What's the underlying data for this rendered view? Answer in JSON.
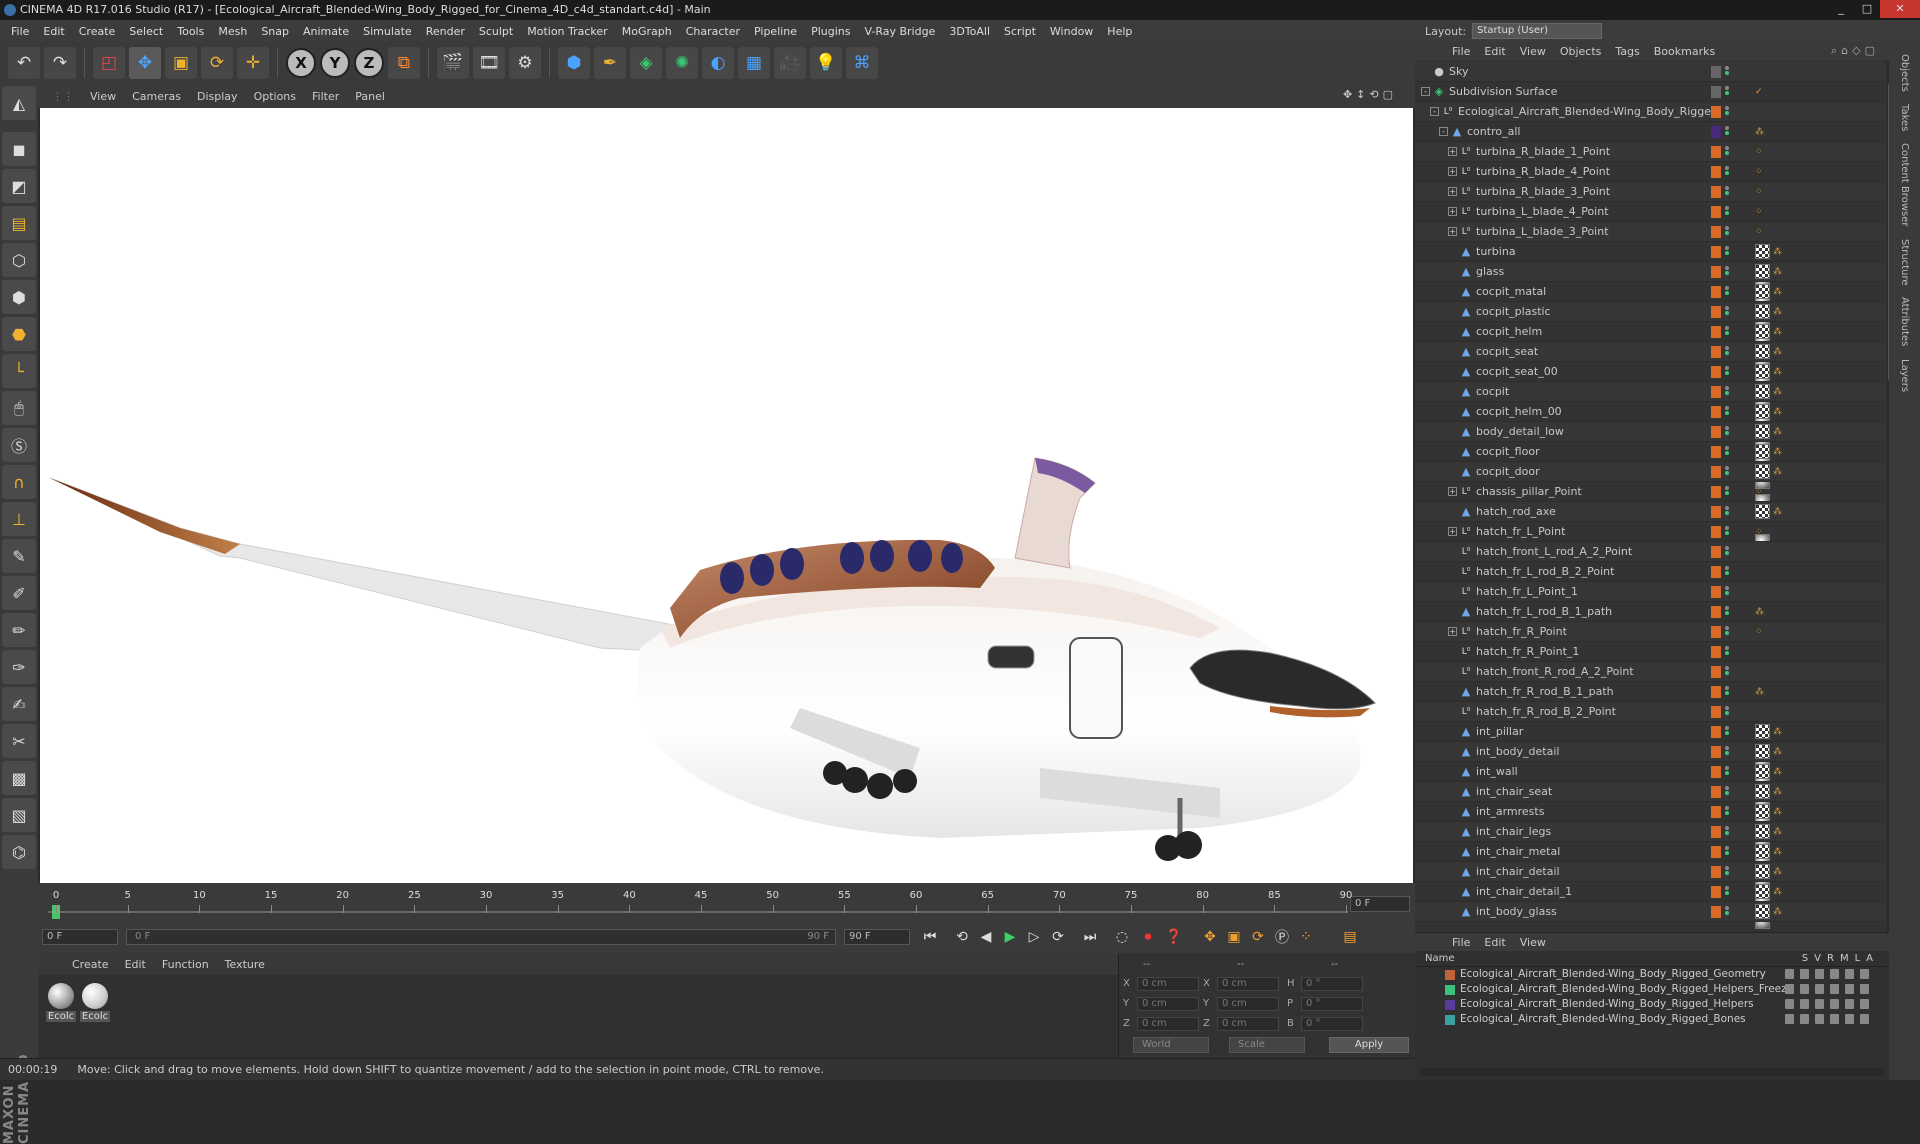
{
  "window": {
    "title": "CINEMA 4D R17.016 Studio (R17) - [Ecological_Aircraft_Blended-Wing_Body_Rigged_for_Cinema_4D_c4d_standart.c4d] - Main",
    "min": "_",
    "max": "□",
    "close": "✕"
  },
  "menubar": [
    "File",
    "Edit",
    "Create",
    "Select",
    "Tools",
    "Mesh",
    "Snap",
    "Animate",
    "Simulate",
    "Render",
    "Sculpt",
    "Motion Tracker",
    "MoGraph",
    "Character",
    "Pipeline",
    "Plugins",
    "V-Ray Bridge",
    "3DToAll",
    "Script",
    "Window",
    "Help"
  ],
  "layout": {
    "label": "Layout:",
    "value": "Startup (User)"
  },
  "viewport_menu": [
    "View",
    "Cameras",
    "Display",
    "Options",
    "Filter",
    "Panel"
  ],
  "timeline": {
    "ticks": [
      "0",
      "5",
      "10",
      "15",
      "20",
      "25",
      "30",
      "35",
      "40",
      "45",
      "50",
      "55",
      "60",
      "65",
      "70",
      "75",
      "80",
      "85",
      "90"
    ],
    "current_frame": "0 F",
    "start": "0 F",
    "slider_start": "0 F",
    "slider_end": "90 F",
    "end": "90 F",
    "current_value": 0
  },
  "material_panel": {
    "menu": [
      "Create",
      "Edit",
      "Function",
      "Texture"
    ],
    "materials": [
      {
        "name": "Ecolc"
      },
      {
        "name": "Ecolc"
      }
    ]
  },
  "coords": {
    "rows": [
      {
        "a": "X",
        "av": "0 cm",
        "b": "X",
        "bv": "0 cm",
        "c": "H",
        "cv": "0 °"
      },
      {
        "a": "Y",
        "av": "0 cm",
        "b": "Y",
        "bv": "0 cm",
        "c": "P",
        "cv": "0 °"
      },
      {
        "a": "Z",
        "av": "0 cm",
        "b": "Z",
        "bv": "0 cm",
        "c": "B",
        "cv": "0 °"
      }
    ],
    "header1": "--",
    "header2": "--",
    "header3": "--",
    "mode": "World",
    "scale": "Scale",
    "apply": "Apply"
  },
  "status": {
    "time": "00:00:19",
    "message": "Move: Click and drag to move elements. Hold down SHIFT to quantize movement / add to the selection in point mode, CTRL to remove."
  },
  "objects_menu": [
    "File",
    "Edit",
    "View",
    "Objects",
    "Tags",
    "Bookmarks"
  ],
  "objects": [
    {
      "name": "Sky",
      "indent": 0,
      "icon": "sky-icon",
      "exp": "",
      "color": "",
      "tags": "none"
    },
    {
      "name": "Subdivision Surface",
      "indent": 0,
      "icon": "subdivision-icon",
      "exp": "-",
      "color": "",
      "tags": "check"
    },
    {
      "name": "Ecological_Aircraft_Blended-Wing_Body_Rigged",
      "indent": 1,
      "icon": "null-icon",
      "exp": "-",
      "color": "#d96a2a",
      "tags": "none"
    },
    {
      "name": "contro_all",
      "indent": 2,
      "icon": "polygon-icon",
      "exp": "-",
      "color": "#4a2a7a",
      "tags": "dot"
    },
    {
      "name": "turbina_R_blade_1_Point",
      "indent": 3,
      "icon": "null-icon",
      "exp": "+",
      "color": "#d96a2a",
      "tags": "grid"
    },
    {
      "name": "turbina_R_blade_4_Point",
      "indent": 3,
      "icon": "null-icon",
      "exp": "+",
      "color": "#d96a2a",
      "tags": "grid"
    },
    {
      "name": "turbina_R_blade_3_Point",
      "indent": 3,
      "icon": "null-icon",
      "exp": "+",
      "color": "#d96a2a",
      "tags": "grid"
    },
    {
      "name": "turbina_L_blade_4_Point",
      "indent": 3,
      "icon": "null-icon",
      "exp": "+",
      "color": "#d96a2a",
      "tags": "grid"
    },
    {
      "name": "turbina_L_blade_3_Point",
      "indent": 3,
      "icon": "null-icon",
      "exp": "+",
      "color": "#d96a2a",
      "tags": "grid"
    },
    {
      "name": "turbina",
      "indent": 3,
      "icon": "polygon-icon",
      "exp": "",
      "color": "#d96a2a",
      "tags": "mat"
    },
    {
      "name": "glass",
      "indent": 3,
      "icon": "polygon-icon",
      "exp": "",
      "color": "#d96a2a",
      "tags": "mat"
    },
    {
      "name": "cocpit_matal",
      "indent": 3,
      "icon": "polygon-icon",
      "exp": "",
      "color": "#d96a2a",
      "tags": "mat"
    },
    {
      "name": "cocpit_plastic",
      "indent": 3,
      "icon": "polygon-icon",
      "exp": "",
      "color": "#d96a2a",
      "tags": "mat"
    },
    {
      "name": "cocpit_helm",
      "indent": 3,
      "icon": "polygon-icon",
      "exp": "",
      "color": "#d96a2a",
      "tags": "mat"
    },
    {
      "name": "cocpit_seat",
      "indent": 3,
      "icon": "polygon-icon",
      "exp": "",
      "color": "#d96a2a",
      "tags": "mat"
    },
    {
      "name": "cocpit_seat_00",
      "indent": 3,
      "icon": "polygon-icon",
      "exp": "",
      "color": "#d96a2a",
      "tags": "mat"
    },
    {
      "name": "cocpit",
      "indent": 3,
      "icon": "polygon-icon",
      "exp": "",
      "color": "#d96a2a",
      "tags": "mat"
    },
    {
      "name": "cocpit_helm_00",
      "indent": 3,
      "icon": "polygon-icon",
      "exp": "",
      "color": "#d96a2a",
      "tags": "mat"
    },
    {
      "name": "body_detail_low",
      "indent": 3,
      "icon": "polygon-icon",
      "exp": "",
      "color": "#d96a2a",
      "tags": "mat"
    },
    {
      "name": "cocpit_floor",
      "indent": 3,
      "icon": "polygon-icon",
      "exp": "",
      "color": "#d96a2a",
      "tags": "mat"
    },
    {
      "name": "cocpit_door",
      "indent": 3,
      "icon": "polygon-icon",
      "exp": "",
      "color": "#d96a2a",
      "tags": "mat"
    },
    {
      "name": "chassis_pillar_Point",
      "indent": 3,
      "icon": "null-icon",
      "exp": "+",
      "color": "#d96a2a",
      "tags": "grid"
    },
    {
      "name": "hatch_rod_axe",
      "indent": 3,
      "icon": "polygon-icon",
      "exp": "",
      "color": "#d96a2a",
      "tags": "mat"
    },
    {
      "name": "hatch_fr_L_Point",
      "indent": 3,
      "icon": "null-icon",
      "exp": "+",
      "color": "#d96a2a",
      "tags": "grid"
    },
    {
      "name": "hatch_front_L_rod_A_2_Point",
      "indent": 3,
      "icon": "null-icon",
      "exp": "",
      "color": "#d96a2a",
      "tags": "none"
    },
    {
      "name": "hatch_fr_L_rod_B_2_Point",
      "indent": 3,
      "icon": "null-icon",
      "exp": "",
      "color": "#d96a2a",
      "tags": "none"
    },
    {
      "name": "hatch_fr_L_Point_1",
      "indent": 3,
      "icon": "null-icon",
      "exp": "",
      "color": "#d96a2a",
      "tags": "none"
    },
    {
      "name": "hatch_fr_L_rod_B_1_path",
      "indent": 3,
      "icon": "spline-icon",
      "exp": "",
      "color": "#d96a2a",
      "tags": "dot"
    },
    {
      "name": "hatch_fr_R_Point",
      "indent": 3,
      "icon": "null-icon",
      "exp": "+",
      "color": "#d96a2a",
      "tags": "grid"
    },
    {
      "name": "hatch_fr_R_Point_1",
      "indent": 3,
      "icon": "null-icon",
      "exp": "",
      "color": "#d96a2a",
      "tags": "none"
    },
    {
      "name": "hatch_front_R_rod_A_2_Point",
      "indent": 3,
      "icon": "null-icon",
      "exp": "",
      "color": "#d96a2a",
      "tags": "none"
    },
    {
      "name": "hatch_fr_R_rod_B_1_path",
      "indent": 3,
      "icon": "spline-icon",
      "exp": "",
      "color": "#d96a2a",
      "tags": "dot"
    },
    {
      "name": "hatch_fr_R_rod_B_2_Point",
      "indent": 3,
      "icon": "null-icon",
      "exp": "",
      "color": "#d96a2a",
      "tags": "none"
    },
    {
      "name": "int_pillar",
      "indent": 3,
      "icon": "polygon-icon",
      "exp": "",
      "color": "#d96a2a",
      "tags": "mat"
    },
    {
      "name": "int_body_detail",
      "indent": 3,
      "icon": "polygon-icon",
      "exp": "",
      "color": "#d96a2a",
      "tags": "mat"
    },
    {
      "name": "int_wall",
      "indent": 3,
      "icon": "polygon-icon",
      "exp": "",
      "color": "#d96a2a",
      "tags": "mat"
    },
    {
      "name": "int_chair_seat",
      "indent": 3,
      "icon": "polygon-icon",
      "exp": "",
      "color": "#d96a2a",
      "tags": "mat"
    },
    {
      "name": "int_armrests",
      "indent": 3,
      "icon": "polygon-icon",
      "exp": "",
      "color": "#d96a2a",
      "tags": "mat"
    },
    {
      "name": "int_chair_legs",
      "indent": 3,
      "icon": "polygon-icon",
      "exp": "",
      "color": "#d96a2a",
      "tags": "mat"
    },
    {
      "name": "int_chair_metal",
      "indent": 3,
      "icon": "polygon-icon",
      "exp": "",
      "color": "#d96a2a",
      "tags": "mat"
    },
    {
      "name": "int_chair_detail",
      "indent": 3,
      "icon": "polygon-icon",
      "exp": "",
      "color": "#d96a2a",
      "tags": "mat"
    },
    {
      "name": "int_chair_detail_1",
      "indent": 3,
      "icon": "polygon-icon",
      "exp": "",
      "color": "#d96a2a",
      "tags": "mat"
    },
    {
      "name": "int_body_glass",
      "indent": 3,
      "icon": "polygon-icon",
      "exp": "",
      "color": "#d96a2a",
      "tags": "mat"
    }
  ],
  "layers_menu": [
    "File",
    "Edit",
    "View"
  ],
  "layers_header": {
    "name": "Name",
    "cols": [
      "S",
      "V",
      "R",
      "M",
      "L",
      "A"
    ]
  },
  "layers": [
    {
      "name": "Ecological_Aircraft_Blended-Wing_Body_Rigged_Geometry",
      "color": "#c0623a"
    },
    {
      "name": "Ecological_Aircraft_Blended-Wing_Body_Rigged_Helpers_Freeze",
      "color": "#3ac07a"
    },
    {
      "name": "Ecological_Aircraft_Blended-Wing_Body_Rigged_Helpers",
      "color": "#5a3a9a"
    },
    {
      "name": "Ecological_Aircraft_Blended-Wing_Body_Rigged_Bones",
      "color": "#3aa0a0"
    }
  ],
  "right_tabs": [
    "Objects",
    "Takes",
    "Content Browser",
    "Structure",
    "Attributes",
    "Layers"
  ],
  "brand": "MAXON CINEMA 4D"
}
